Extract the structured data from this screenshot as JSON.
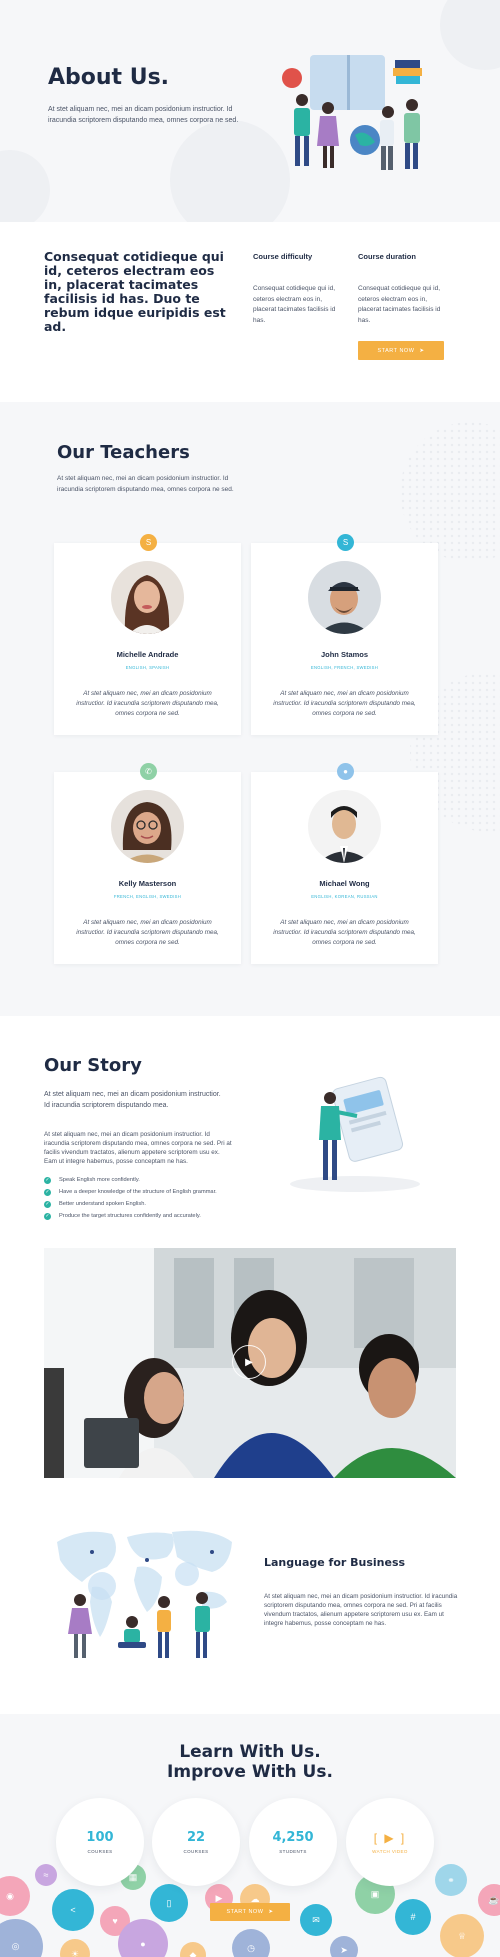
{
  "about": {
    "title": "About Us.",
    "text": "At stet aliquam nec, mei an dicam posidonium instructior. Id iracundia scriptorem disputando mea, omnes corpora ne sed."
  },
  "course": {
    "heading": "Consequat cotidieque qui id, ceteros electram eos in, placerat tacimates facilisis id has. Duo te rebum idque euripidis est ad.",
    "difficulty_label": "Course difficulty",
    "difficulty_text": "Consequat cotidieque qui id, ceteros electram eos in, placerat tacimates facilisis id has.",
    "duration_label": "Course duration",
    "duration_text": "Consequat cotidieque qui id, ceteros electram eos in, placerat tacimates facilisis id has.",
    "button": "START NOW"
  },
  "teachers": {
    "title": "Our Teachers",
    "intro": "At stet aliquam nec, mei an dicam posidonium instructior. Id iracundia scriptorem disputando mea, omnes corpora ne sed.",
    "cards": [
      {
        "name": "Michelle Andrade",
        "langs": "ENGLISH, SPANISH",
        "bio": "At stet aliquam nec, mei an dicam posidonium instructior. Id iracundia scriptorem disputando mea, omnes corpora ne sed.",
        "badge_color": "#f4b043",
        "badge_icon": "skype-icon"
      },
      {
        "name": "John Stamos",
        "langs": "ENGLISH, FRENCH, SWEDISH",
        "bio": "At stet aliquam nec, mei an dicam posidonium instructior. Id iracundia scriptorem disputando mea, omnes corpora ne sed.",
        "badge_color": "#33b6d6",
        "badge_icon": "skype-icon"
      },
      {
        "name": "Kelly Masterson",
        "langs": "FRENCH, ENGLISH, SWEDISH",
        "bio": "At stet aliquam nec, mei an dicam posidonium instructior. Id iracundia scriptorem disputando mea, omnes corpora ne sed.",
        "badge_color": "#8fd1a6",
        "badge_icon": "whatsapp-icon"
      },
      {
        "name": "Michael Wong",
        "langs": "ENGLISH, KOREAN, RUSSIAN",
        "bio": "At stet aliquam nec, mei an dicam posidonium instructior. Id iracundia scriptorem disputando mea, omnes corpora ne sed.",
        "badge_color": "#8fc3ea",
        "badge_icon": "wechat-icon"
      }
    ]
  },
  "story": {
    "title": "Our Story",
    "lead": "At stet aliquam nec, mei an dicam posidonium instructior. Id iracundia scriptorem disputando mea.",
    "body": "At stet aliquam nec, mei an dicam posidonium instructior. Id iracundia scriptorem disputando mea, omnes corpora ne sed. Pri at facilis vivendum tractatos, alienum appetere scriptorem usu ex. Eam ut integre habemus, posse conceptam ne has.",
    "list": [
      "Speak English more confidently.",
      "Have a deeper knowledge of the structure of English grammar.",
      "Better understand spoken English.",
      "Produce the target structures confidently and accurately."
    ]
  },
  "business": {
    "title": "Language for Business",
    "text": "At stet aliquam nec, mei an dicam posidonium instructior. Id iracundia scriptorem disputando mea, omnes corpora ne sed. Pri at facilis vivendum tractatos, alienum appetere scriptorem usu ex. Eam ut integre habemus, posse conceptam ne has."
  },
  "learn": {
    "title_line1": "Learn With Us.",
    "title_line2": "Improve With Us.",
    "stats": [
      {
        "value": "100",
        "label": "COURSES"
      },
      {
        "value": "22",
        "label": "COURSES"
      },
      {
        "value": "4,250",
        "label": "STUDENTS"
      }
    ],
    "video_label": "WATCH VIDEO",
    "button": "START NOW"
  },
  "colors": {
    "accent_orange": "#f4b043",
    "accent_cyan": "#33b6d6",
    "heading_navy": "#1f2b44",
    "check_green": "#2bb3a3"
  }
}
